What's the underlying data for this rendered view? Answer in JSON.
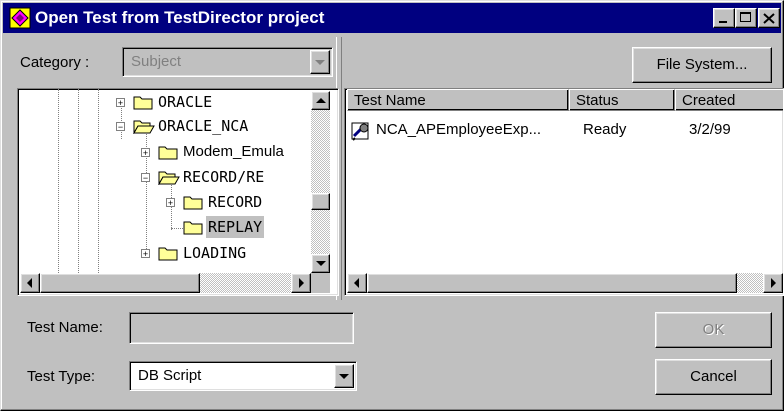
{
  "window": {
    "title": "Open Test from TestDirector project"
  },
  "category": {
    "label": "Category :",
    "value": "Subject"
  },
  "toolbar": {
    "file_system_label": "File System..."
  },
  "tree": {
    "items": [
      {
        "label": "ORACLE",
        "expander": "+",
        "selected": false
      },
      {
        "label": "ORACLE_NCA",
        "expander": "−",
        "selected": false
      },
      {
        "label": "Modem_Emula",
        "expander": "+",
        "selected": false
      },
      {
        "label": "RECORD/RE",
        "expander": "−",
        "selected": false
      },
      {
        "label": "RECORD",
        "expander": "+",
        "selected": false
      },
      {
        "label": "REPLAY",
        "expander": "",
        "selected": true
      },
      {
        "label": "LOADING",
        "expander": "+",
        "selected": false
      }
    ]
  },
  "tests_table": {
    "columns": [
      "Test Name",
      "Status",
      "Created"
    ],
    "rows": [
      {
        "name": "NCA_APEmployeeExp...",
        "status": "Ready",
        "created": "3/2/99"
      }
    ]
  },
  "form": {
    "test_name_label": "Test Name:",
    "test_name_value": "",
    "test_type_label": "Test Type:",
    "test_type_value": "DB Script"
  },
  "buttons": {
    "ok_label": "OK",
    "cancel_label": "Cancel"
  },
  "colors": {
    "titlebar": "#000080",
    "face": "#c0c0c0",
    "folder": "#ffff99"
  }
}
